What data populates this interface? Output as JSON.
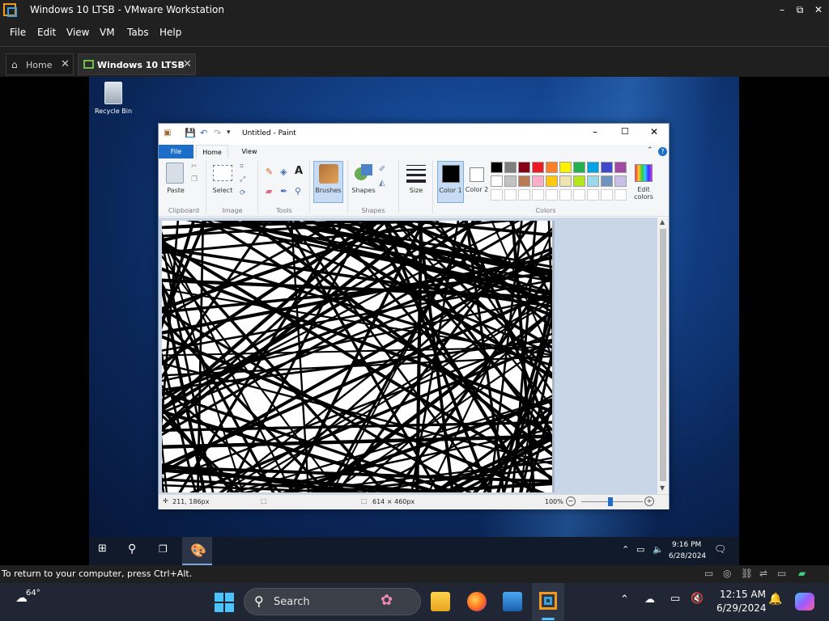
{
  "vmware": {
    "window_title": "Windows 10 LTSB - VMware Workstation",
    "controls": {
      "minimize": "–",
      "maximize": "⧉",
      "close": "✕"
    },
    "menu": [
      "File",
      "Edit",
      "View",
      "VM",
      "Tabs",
      "Help"
    ],
    "tabs": [
      {
        "label": "Home",
        "close": "✕"
      },
      {
        "label": "Windows 10 LTSB",
        "close": "✕"
      }
    ],
    "status_message": "To return to your computer, press Ctrl+Alt."
  },
  "guest": {
    "desktop": {
      "recycle_bin_label": "Recycle Bin"
    },
    "taskbar": {
      "time": "9:16 PM",
      "date": "6/28/2024"
    },
    "paint": {
      "title": "Untitled - Paint",
      "tabs": [
        "File",
        "Home",
        "View"
      ],
      "ribbon": {
        "paste": "Paste",
        "select": "Select",
        "brushes": "Brushes",
        "shapes": "Shapes",
        "size": "Size",
        "color1": "Color 1",
        "color2": "Color 2",
        "edit_colors": "Edit colors",
        "groups": [
          "Clipboard",
          "Image",
          "Tools",
          "Shapes",
          "Colors"
        ]
      },
      "palette_row1": [
        "#000000",
        "#7f7f7f",
        "#880015",
        "#ed1c24",
        "#ff7f27",
        "#fff200",
        "#22b14c",
        "#00a2e8",
        "#3f48cc",
        "#a349a4"
      ],
      "palette_row2": [
        "#ffffff",
        "#c3c3c3",
        "#b97a57",
        "#ffaec9",
        "#ffc90e",
        "#efe4b0",
        "#b5e61d",
        "#99d9ea",
        "#7092be",
        "#c8bfe7"
      ],
      "status": {
        "cursor_pos": "211, 186px",
        "image_size": "614 × 460px",
        "zoom": "100%"
      }
    }
  },
  "host": {
    "taskbar": {
      "weather_temp": "64°",
      "search_label": "Search",
      "time": "12:15 AM",
      "date": "6/29/2024"
    }
  }
}
